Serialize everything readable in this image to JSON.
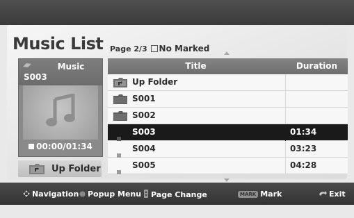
{
  "screen": {
    "title": "Music List",
    "page_info": "Page 2/3",
    "marked_status": "No Marked"
  },
  "preview": {
    "type_label": "Music",
    "item_name": "S003",
    "time": "00:00/01:34"
  },
  "up_folder_button": {
    "label": "Up Folder"
  },
  "list": {
    "columns": {
      "title": "Title",
      "duration": "Duration"
    },
    "rows": [
      {
        "name": "Up Folder",
        "duration": "",
        "icon": "up-folder-icon"
      },
      {
        "name": "S001",
        "duration": "",
        "icon": "folder-icon"
      },
      {
        "name": "S002",
        "duration": "",
        "icon": "folder-icon"
      },
      {
        "name": "S003",
        "duration": "01:34",
        "icon": "music-file-icon",
        "selected": true
      },
      {
        "name": "S004",
        "duration": "03:23",
        "icon": "music-file-icon"
      },
      {
        "name": "S005",
        "duration": "04:28",
        "icon": "music-file-icon"
      }
    ]
  },
  "footer": {
    "navigation": "Navigation",
    "popup_menu": "Popup Menu",
    "page_change": "Page Change",
    "mark_badge": "MARK",
    "mark": "Mark",
    "exit": "Exit"
  },
  "colors": {
    "selected_row": "#1a1a1a",
    "header": "#7a7a7a",
    "footer": "#3f3f3f"
  }
}
